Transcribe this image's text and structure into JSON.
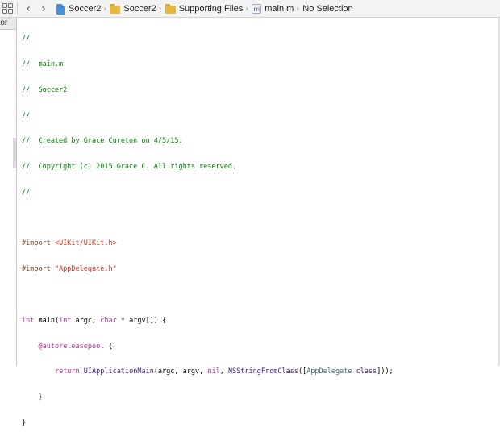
{
  "jump_bar": {
    "project": "Soccer2",
    "group": "Soccer2",
    "subgroup": "Supporting Files",
    "file": "main.m",
    "selection": "No Selection",
    "file_icon_glyph": "m"
  },
  "navigator": {
    "tab_label": "ator"
  },
  "code": {
    "l1": "//",
    "l2": "//  main.m",
    "l3": "//  Soccer2",
    "l4": "//",
    "l5": "//  Created by Grace Cureton on 4/5/15.",
    "l6": "//  Copyright (c) 2015 Grace C. All rights reserved.",
    "l7": "//",
    "import1_kw": "#import ",
    "import1_path": "<UIKit/UIKit.h>",
    "import2_kw": "#import ",
    "import2_path": "\"AppDelegate.h\"",
    "main_int": "int",
    "main_sig1": " main(",
    "main_int2": "int",
    "main_sig2": " argc, ",
    "main_char": "char",
    "main_sig3": " * argv[]) {",
    "pool_indent": "    ",
    "pool": "@autoreleasepool",
    "pool_brace": " {",
    "ret_indent": "        ",
    "ret_kw": "return",
    "ret_sp": " ",
    "ret_fn": "UIApplicationMain",
    "ret_args": "(argc, argv, ",
    "ret_nil": "nil",
    "ret_comma": ", ",
    "ret_ns": "NSStringFromClass",
    "ret_open": "([",
    "ret_cls": "AppDelegate",
    "ret_sp2": " ",
    "ret_class": "class",
    "ret_close": "]));",
    "close1": "    }",
    "close2": "}"
  },
  "colors": {
    "comment": "#008400",
    "preprocessor": "#78492a",
    "string": "#d12f1b",
    "keyword": "#bb2ca2",
    "system_class": "#3d1d81",
    "project_class": "#3f6e74"
  }
}
